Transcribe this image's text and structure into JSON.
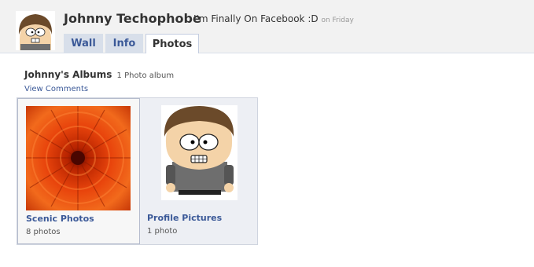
{
  "profile": {
    "name": "Johnny Techophobe",
    "status": "I'm Finally On Facebook :D",
    "status_time": "on Friday"
  },
  "tabs": [
    {
      "label": "Wall"
    },
    {
      "label": "Info"
    },
    {
      "label": "Photos",
      "active": true
    }
  ],
  "albums_section": {
    "title": "Johnny's Albums",
    "count": "1 Photo album",
    "view_comments": "View Comments"
  },
  "albums": [
    {
      "title": "Scenic Photos",
      "count": "8 photos",
      "thumbnail": "orange-flower-photo"
    },
    {
      "title": "Profile Pictures",
      "count": "1 photo",
      "thumbnail": "cartoon-avatar"
    }
  ],
  "colors": {
    "link": "#3b5998",
    "tab_bg": "#d8dfea",
    "header_bg": "#f2f2f2",
    "album_bg": "#edeff4"
  }
}
